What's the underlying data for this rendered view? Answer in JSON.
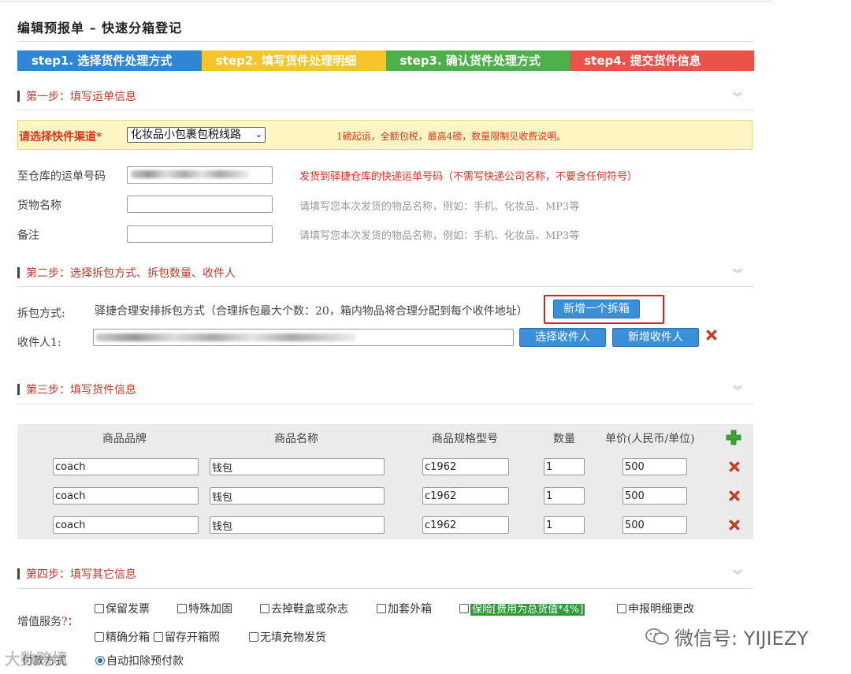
{
  "page_title": "编辑预报单  –  快速分箱登记",
  "steps": [
    {
      "label": "step1. 选择货件处理方式",
      "color": "#2e86d4"
    },
    {
      "label": "step2. 填写货件处理明细",
      "color": "#f6c42b"
    },
    {
      "label": "step3. 确认货件处理方式",
      "color": "#4db04a"
    },
    {
      "label": "step4. 提交货件信息",
      "color": "#e9534a"
    }
  ],
  "section1": {
    "title": "第一步：填写运单信息",
    "channel_label": "请选择快件渠道*",
    "channel_value": "化妆品小包裹包税线路",
    "channel_note": "1磅起运，全额包税，最高4磅，数量限制见收费说明。",
    "tracking_label": "至仓库的运单号码",
    "tracking_hint": "发货到驿捷仓库的快递运单号码（不需写快递公司名称，不要含任何符号）",
    "goods_label": "货物名称",
    "goods_hint": "请填写您本次发货的物品名称，例如：手机、化妆品、MP3等",
    "remark_label": "备注",
    "remark_hint": "请填写您本次发货的物品名称，例如：手机、化妆品、MP3等"
  },
  "section2": {
    "title": "第二步：选择拆包方式、拆包数量、收件人",
    "split_label": "拆包方式:",
    "split_desc": "驿捷合理安排拆包方式（合理拆包最大个数：20，箱内物品将合理分配到每个收件地址）",
    "add_box_button": "新增一个拆箱",
    "recipient_label": "收件人1:",
    "select_recipient_button": "选择收件人",
    "add_recipient_button": "新增收件人"
  },
  "section3": {
    "title": "第三步：填写货件信息",
    "headers": [
      "商品品牌",
      "商品名称",
      "商品规格型号",
      "数量",
      "单价(人民币/单位)"
    ],
    "rows": [
      {
        "brand": "coach",
        "name": "钱包",
        "model": "c1962",
        "qty": "1",
        "price": "500"
      },
      {
        "brand": "coach",
        "name": "钱包",
        "model": "c1962",
        "qty": "1",
        "price": "500"
      },
      {
        "brand": "coach",
        "name": "钱包",
        "model": "c1962",
        "qty": "1",
        "price": "500"
      }
    ]
  },
  "section4": {
    "title": "第四步：填写其它信息",
    "value_service_label": "增值服务",
    "value_service_q": "?",
    "value_service_colon": "：",
    "services_row1": [
      "保留发票",
      "特殊加固",
      "去掉鞋盒或杂志",
      "加套外箱",
      "保险[费用为总货值*4%]",
      "申报明细更改"
    ],
    "services_row2": [
      "精确分箱",
      "留存开箱照",
      "无填充物发货"
    ],
    "payment_label": "付款方式",
    "payment_option": "自动扣除预付款"
  },
  "watermark": {
    "wechat": "微信号: YIJIEZY",
    "corner": "大数跨境"
  }
}
